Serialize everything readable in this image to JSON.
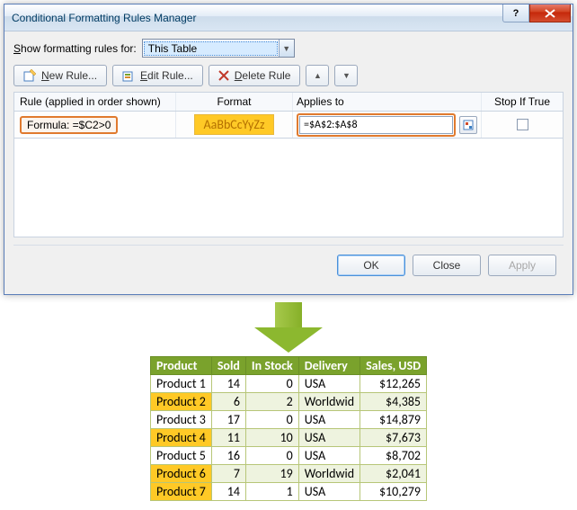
{
  "dialog": {
    "title": "Conditional Formatting Rules Manager",
    "show_label_pre": "S",
    "show_label_post": "how formatting rules for:",
    "scope": "This Table",
    "buttons": {
      "new": "New Rule...",
      "edit": "Edit Rule...",
      "delete": "Delete Rule"
    },
    "headers": {
      "rule": "Rule (applied in order shown)",
      "format": "Format",
      "applies": "Applies to",
      "stop": "Stop If True"
    },
    "rule": {
      "formula_text": "Formula: =$C2>0",
      "format_preview": "AaBbCcYyZz",
      "applies_to": "=$A$2:$A$8"
    },
    "footer": {
      "ok": "OK",
      "close": "Close",
      "apply": "Apply"
    }
  },
  "table": {
    "headers": [
      "Product",
      "Sold",
      "In Stock",
      "Delivery",
      "Sales,  USD"
    ],
    "rows": [
      {
        "p": "Product 1",
        "sold": "14",
        "stock": "0",
        "d": "USA",
        "s": "$12,265",
        "hl": false,
        "alt": false
      },
      {
        "p": "Product 2",
        "sold": "6",
        "stock": "2",
        "d": "Worldwid",
        "s": "$4,385",
        "hl": true,
        "alt": true
      },
      {
        "p": "Product 3",
        "sold": "17",
        "stock": "0",
        "d": "USA",
        "s": "$14,879",
        "hl": false,
        "alt": false
      },
      {
        "p": "Product 4",
        "sold": "11",
        "stock": "10",
        "d": "USA",
        "s": "$7,673",
        "hl": true,
        "alt": true
      },
      {
        "p": "Product 5",
        "sold": "16",
        "stock": "0",
        "d": "USA",
        "s": "$8,702",
        "hl": false,
        "alt": false
      },
      {
        "p": "Product 6",
        "sold": "7",
        "stock": "19",
        "d": "Worldwid",
        "s": "$2,041",
        "hl": true,
        "alt": true
      },
      {
        "p": "Product 7",
        "sold": "14",
        "stock": "1",
        "d": "USA",
        "s": "$10,279",
        "hl": true,
        "alt": false
      }
    ]
  }
}
